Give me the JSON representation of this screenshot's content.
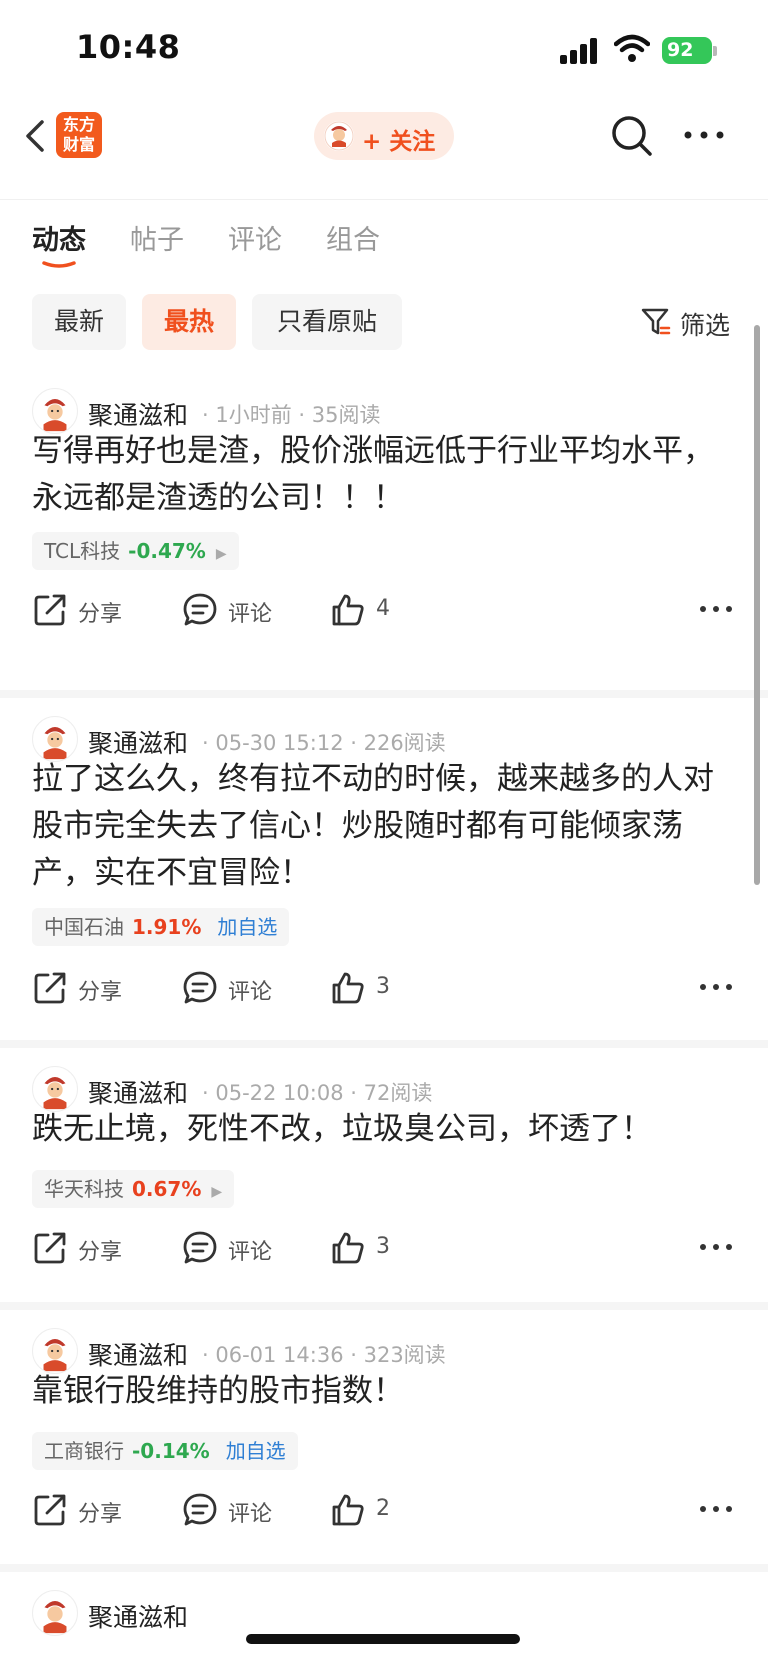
{
  "status_bar": {
    "time": "10:48",
    "battery": "92"
  },
  "nav": {
    "logo_line1": "东方",
    "logo_line2": "财富",
    "follow_label": "+ 关注",
    "icons": {
      "back": "chevron-left-icon",
      "search": "search-icon",
      "more": "more-horizontal-icon"
    }
  },
  "tabs": [
    {
      "label": "动态",
      "active": true
    },
    {
      "label": "帖子",
      "active": false
    },
    {
      "label": "评论",
      "active": false
    },
    {
      "label": "组合",
      "active": false
    }
  ],
  "filters": {
    "chips": [
      {
        "label": "最新",
        "active": false
      },
      {
        "label": "最热",
        "active": true
      },
      {
        "label": "只看原贴",
        "active": false
      }
    ],
    "filter_label": "筛选"
  },
  "action_labels": {
    "share": "分享",
    "comment": "评论"
  },
  "posts": [
    {
      "author": "聚通滋和",
      "meta": "· 1小时前 · 35阅读",
      "body": "写得再好也是渣，股价涨幅远低于行业平均水平，永远都是渣透的公司！！！",
      "stock": {
        "name": "TCL科技",
        "change": "-0.47%",
        "direction": "down",
        "extra": ""
      },
      "likes": "4"
    },
    {
      "author": "聚通滋和",
      "meta": "· 05-30 15:12 · 226阅读",
      "body": "拉了这么久，终有拉不动的时候，越来越多的人对股市完全失去了信心！炒股随时都有可能倾家荡产，实在不宜冒险！",
      "stock": {
        "name": "中国石油",
        "change": "1.91%",
        "direction": "up",
        "extra": "加自选"
      },
      "likes": "3"
    },
    {
      "author": "聚通滋和",
      "meta": "· 05-22 10:08 · 72阅读",
      "body": "跌无止境，死性不改，垃圾臭公司，坏透了！",
      "stock": {
        "name": "华天科技",
        "change": "0.67%",
        "direction": "up",
        "extra": ""
      },
      "likes": "3"
    },
    {
      "author": "聚通滋和",
      "meta": "· 06-01 14:36 · 323阅读",
      "body": "靠银行股维持的股市指数！",
      "stock": {
        "name": "工商银行",
        "change": "-0.14%",
        "direction": "down",
        "extra": "加自选"
      },
      "likes": "2"
    }
  ],
  "colors": {
    "accent": "#f0501e",
    "down": "#2ea84f",
    "up": "#e8411e",
    "link": "#2f7fd4"
  }
}
